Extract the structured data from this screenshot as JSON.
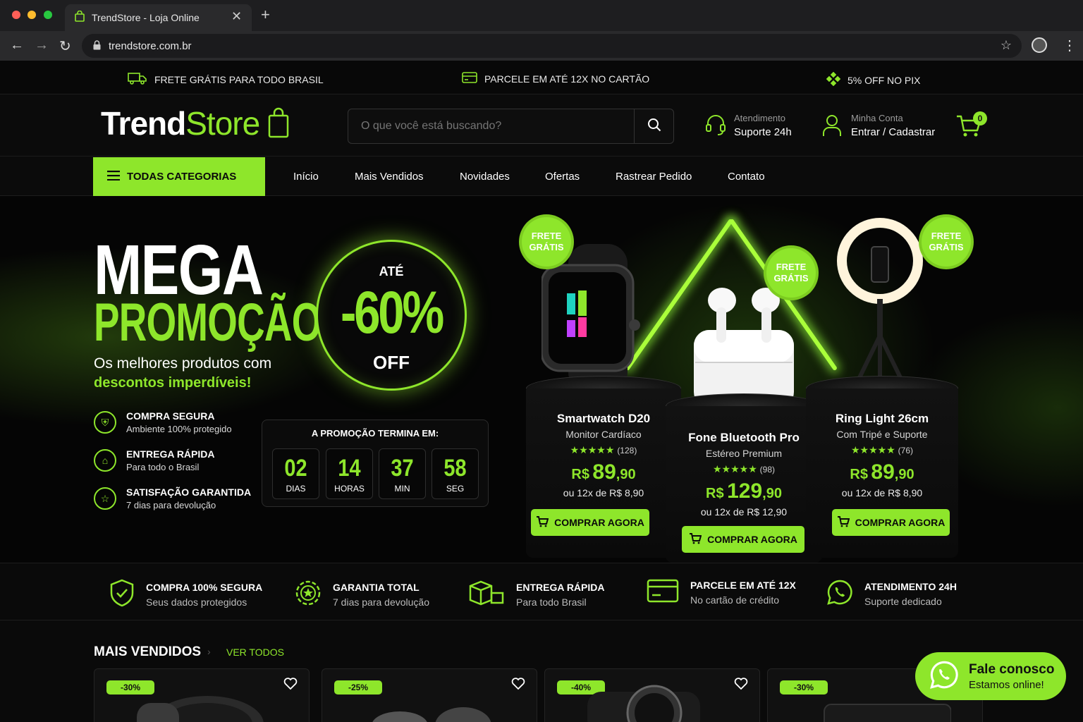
{
  "browser": {
    "tab_title": "TrendStore - Loja Online",
    "url": "trendstore.com.br"
  },
  "topbar": {
    "shipping_pre": "FRETE GRÁTIS",
    "shipping_post": " PARA TODO BRASIL",
    "installments": "PARCELE EM ATÉ 12X NO CARTÃO",
    "pix": "5% OFF NO PIX"
  },
  "header": {
    "logo_trend": "Trend",
    "logo_store": "Store",
    "search_placeholder": "O que você está buscando?",
    "support_small": "Atendimento",
    "support_big": "Suporte 24h",
    "account_small": "Minha Conta",
    "account_big": "Entrar / Cadastrar",
    "cart_count": "0"
  },
  "nav": {
    "categories": "TODAS CATEGORIAS",
    "links": [
      "Início",
      "Mais Vendidos",
      "Novidades",
      "Ofertas",
      "Rastrear Pedido",
      "Contato"
    ]
  },
  "hero": {
    "title1": "MEGA",
    "title2": "PROMOÇÃO",
    "sub1": "Os melhores produtos com",
    "sub2": "descontos imperdíveis!",
    "features": [
      {
        "title": "COMPRA SEGURA",
        "sub": "Ambiente 100% protegido"
      },
      {
        "title": "ENTREGA RÁPIDA",
        "sub": "Para todo o Brasil"
      },
      {
        "title": "SATISFAÇÃO GARANTIDA",
        "sub": "7 dias para devolução"
      }
    ],
    "discount_pre": "ATÉ",
    "discount_value": "-60%",
    "discount_post": "OFF",
    "countdown_title": "A PROMOÇÃO TERMINA EM:",
    "countdown": [
      {
        "num": "02",
        "label": "DIAS"
      },
      {
        "num": "14",
        "label": "HORAS"
      },
      {
        "num": "37",
        "label": "MIN"
      },
      {
        "num": "58",
        "label": "SEG"
      }
    ],
    "free_shipping_l1": "FRETE",
    "free_shipping_l2": "GRÁTIS",
    "products": [
      {
        "name": "Smartwatch D20",
        "sub": "Monitor Cardíaco",
        "stars": "★★★★★",
        "reviews": "(128)",
        "currency": "R$",
        "int": "89",
        "dec": ",90",
        "installment": "ou 12x de R$ 8,90",
        "button": "COMPRAR AGORA"
      },
      {
        "name": "Fone Bluetooth Pro",
        "sub": "Estéreo Premium",
        "stars": "★★★★★",
        "reviews": "(98)",
        "currency": "R$",
        "int": "129",
        "dec": ",90",
        "installment": "ou 12x de R$ 12,90",
        "button": "COMPRAR AGORA"
      },
      {
        "name": "Ring Light 26cm",
        "sub": "Com Tripé e Suporte",
        "stars": "★★★★★",
        "reviews": "(76)",
        "currency": "R$",
        "int": "89",
        "dec": ",90",
        "installment": "ou 12x de R$ 8,90",
        "button": "COMPRAR AGORA"
      }
    ]
  },
  "trust": [
    {
      "title": "COMPRA 100% SEGURA",
      "sub": "Seus dados protegidos",
      "icon": "shield-check-icon"
    },
    {
      "title": "GARANTIA TOTAL",
      "sub": "7 dias para devolução",
      "icon": "badge-star-icon"
    },
    {
      "title": "ENTREGA RÁPIDA",
      "sub": "Para todo Brasil",
      "icon": "boxes-icon"
    },
    {
      "title": "PARCELE EM ATÉ 12X",
      "sub": "No cartão de crédito",
      "icon": "credit-card-icon"
    },
    {
      "title": "ATENDIMENTO 24H",
      "sub": "Suporte dedicado",
      "icon": "whatsapp-icon"
    }
  ],
  "best_sellers": {
    "title": "MAIS VENDIDOS",
    "link": "VER TODOS",
    "badges": [
      "-30%",
      "-25%",
      "-40%",
      "-30%"
    ]
  },
  "chat": {
    "title": "Fale conosco",
    "sub": "Estamos online!"
  },
  "colors": {
    "accent": "#8ee62b",
    "background": "#0a0a0a"
  }
}
